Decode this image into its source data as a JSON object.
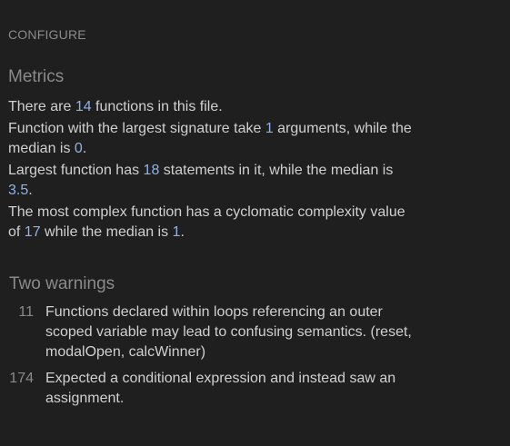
{
  "header": {
    "configure_label": "CONFIGURE"
  },
  "metrics": {
    "title": "Metrics",
    "function_count": {
      "pre": "There are ",
      "value": "14",
      "post": " functions in this file."
    },
    "signature": {
      "pre": "Function with the largest signature take ",
      "value": "1",
      "mid": " arguments, while the median is ",
      "median": "0",
      "post": "."
    },
    "statements": {
      "pre": "Largest function has ",
      "value": "18",
      "mid": " statements in it, while the median is ",
      "median": "3.5",
      "post": "."
    },
    "complexity": {
      "pre": "The most complex function has a cyclomatic complexity value of ",
      "value": "17",
      "mid": " while the median is ",
      "median": "1",
      "post": "."
    }
  },
  "warnings": {
    "title": "Two warnings",
    "items": [
      {
        "line": "11",
        "text": "Functions declared within loops referencing an outer scoped variable may lead to confusing semantics. (reset, modalOpen, calcWinner)"
      },
      {
        "line": "174",
        "text": "Expected a conditional expression and instead saw an assignment."
      }
    ]
  },
  "colors": {
    "background": "#1f1f1f",
    "text": "#d0d0d0",
    "muted": "#8a8a8a",
    "number": "#8fb1e8"
  }
}
